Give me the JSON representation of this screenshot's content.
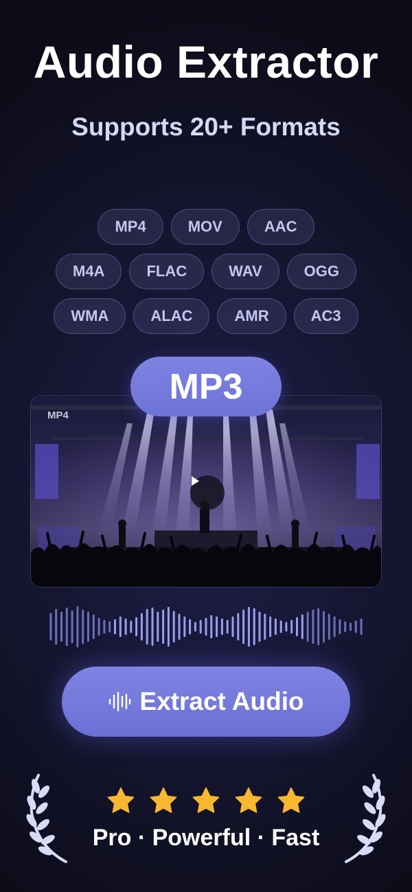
{
  "header": {
    "title": "Audio Extractor",
    "subtitle": "Supports 20+ Formats"
  },
  "formats": [
    [
      "MP4",
      "MOV",
      "AAC"
    ],
    [
      "M4A",
      "FLAC",
      "WAV",
      "OGG"
    ],
    [
      "WMA",
      "ALAC",
      "AMR",
      "AC3"
    ]
  ],
  "output_format": "MP3",
  "video": {
    "source_tag": "MP4",
    "play_icon": "play-icon"
  },
  "extract_button": {
    "label": "Extract Audio",
    "icon": "waveform-icon"
  },
  "rating": {
    "stars": 5,
    "star_color": "#f7b731",
    "tagline": "Pro · Powerful · Fast"
  },
  "colors": {
    "accent": "#7479dc",
    "background": "#12122a"
  }
}
